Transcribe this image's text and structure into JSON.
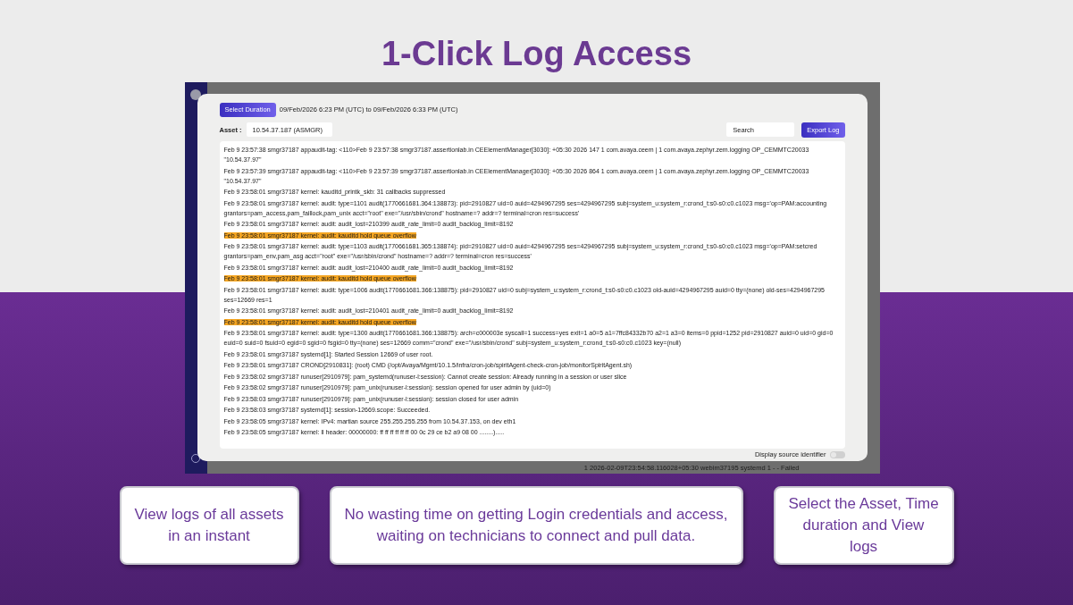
{
  "slide_title": "1-Click Log Access",
  "screenshot": {
    "background_row_text": "1 2026-02-09T23:54:58.116028+05:30 webim37195 systemd 1 - - Failed",
    "dialog": {
      "duration_button": "Select Duration",
      "duration_range": "09/Feb/2026 6:23 PM (UTC) to 09/Feb/2026 6:33 PM (UTC)",
      "asset_label": "Asset :",
      "asset_value": "10.54.37.187 (ASMGR)",
      "search": {
        "placeholder": "Search"
      },
      "export_button": "Export Log",
      "log_lines": [
        {
          "text": "Feb 9 23:57:38 smgr37187 appaudit-tag: <110>Feb 9 23:57:38 smgr37187.assertionlab.in CEElementManager[3030]: +05:30 2026 147 1 com.avaya.ceem | 1 com.avaya.zephyr.zem.logging OP_CEMMTC20033 \"10.54.37.97\"",
          "highlighted": false
        },
        {
          "text": "Feb 9 23:57:39 smgr37187 appaudit-tag: <110>Feb 9 23:57:39 smgr37187.assertionlab.in CEElementManager[3030]: +05:30 2026 864 1 com.avaya.ceem | 1 com.avaya.zephyr.zem.logging OP_CEMMTC20033 \"10.54.37.97\"",
          "highlighted": false
        },
        {
          "text": "Feb 9 23:58:01 smgr37187 kernel: kauditd_printk_skb: 31 callbacks suppressed",
          "highlighted": false
        },
        {
          "text": "Feb 9 23:58:01 smgr37187 kernel: audit: type=1101 audit(1770661681.364:138873): pid=2910827 uid=0 auid=4294967295 ses=4294967295 subj=system_u:system_r:crond_t:s0-s0:c0.c1023 msg='op=PAM:accounting grantors=pam_access,pam_faillock,pam_unix acct=\"root\" exe=\"/usr/sbin/crond\" hostname=? addr=? terminal=cron res=success'",
          "highlighted": false
        },
        {
          "text": "Feb 9 23:58:01 smgr37187 kernel: audit: audit_lost=210399 audit_rate_limit=0 audit_backlog_limit=8192",
          "highlighted": false
        },
        {
          "text": "Feb 9 23:58:01 smgr37187 kernel: audit: kauditd hold queue overflow",
          "highlighted": true
        },
        {
          "text": "Feb 9 23:58:01 smgr37187 kernel: audit: type=1103 audit(1770661681.365:138874): pid=2910827 uid=0 auid=4294967295 ses=4294967295 subj=system_u:system_r:crond_t:s0-s0:c0.c1023 msg='op=PAM:setcred grantors=pam_env,pam_asg acct=\"root\" exe=\"/usr/sbin/crond\" hostname=? addr=? terminal=cron res=success'",
          "highlighted": false
        },
        {
          "text": "Feb 9 23:58:01 smgr37187 kernel: audit: audit_lost=210400 audit_rate_limit=0 audit_backlog_limit=8192",
          "highlighted": false
        },
        {
          "text": "Feb 9 23:58:01 smgr37187 kernel: audit: kauditd hold queue overflow",
          "highlighted": true
        },
        {
          "text": "Feb 9 23:58:01 smgr37187 kernel: audit: type=1006 audit(1770661681.366:138875): pid=2910827 uid=0 subj=system_u:system_r:crond_t:s0-s0:c0.c1023 old-auid=4294967295 auid=0 tty=(none) old-ses=4294967295 ses=12669 res=1",
          "highlighted": false
        },
        {
          "text": "Feb 9 23:58:01 smgr37187 kernel: audit: audit_lost=210401 audit_rate_limit=0 audit_backlog_limit=8192",
          "highlighted": false
        },
        {
          "text": "Feb 9 23:58:01 smgr37187 kernel: audit: kauditd hold queue overflow",
          "highlighted": true
        },
        {
          "text": "Feb 9 23:58:01 smgr37187 kernel: audit: type=1300 audit(1770661681.366:138875): arch=c000003e syscall=1 success=yes exit=1 a0=5 a1=7ffc84332b70 a2=1 a3=0 items=0 ppid=1252 pid=2910827 auid=0 uid=0 gid=0 euid=0 suid=0 fsuid=0 egid=0 sgid=0 fsgid=0 tty=(none) ses=12669 comm=\"crond\" exe=\"/usr/sbin/crond\" subj=system_u:system_r:crond_t:s0-s0:c0.c1023 key=(null)",
          "highlighted": false
        },
        {
          "text": "Feb 9 23:58:01 smgr37187 systemd[1]: Started Session 12669 of user root.",
          "highlighted": false
        },
        {
          "text": "Feb 9 23:58:01 smgr37187 CROND[2910831]: (root) CMD (/opt/Avaya/Mgmt/10.1.5/infra/cron-job/spiritAgent-check-cron-job/monitorSpiritAgent.sh)",
          "highlighted": false
        },
        {
          "text": "Feb 9 23:58:02 smgr37187 runuser[2910979]: pam_systemd(runuser-l:session): Cannot create session: Already running in a session or user slice",
          "highlighted": false
        },
        {
          "text": "Feb 9 23:58:02 smgr37187 runuser[2910979]: pam_unix(runuser-l:session): session opened for user admin by (uid=0)",
          "highlighted": false
        },
        {
          "text": "Feb 9 23:58:03 smgr37187 runuser[2910979]: pam_unix(runuser-l:session): session closed for user admin",
          "highlighted": false
        },
        {
          "text": "Feb 9 23:58:03 smgr37187 systemd[1]: session-12669.scope: Succeeded.",
          "highlighted": false
        },
        {
          "text": "Feb 9 23:58:05 smgr37187 kernel: IPv4: martian source 255.255.255.255 from 10.54.37.153, on dev eth1",
          "highlighted": false
        },
        {
          "text": "Feb 9 23:58:05 smgr37187 kernel: ll header: 00000000: ff ff ff ff ff ff 00 0c 29 ce b2 a9 08 00 ........).....",
          "highlighted": false
        }
      ],
      "source_toggle": {
        "label": "Display source identifier",
        "on": false
      }
    }
  },
  "feature_cards": [
    {
      "text": "View logs of all assets in an instant"
    },
    {
      "text": "No wasting time on getting Login credentials and access, waiting on technicians to connect and pull data."
    },
    {
      "text": "Select the Asset, Time duration and View logs"
    }
  ]
}
